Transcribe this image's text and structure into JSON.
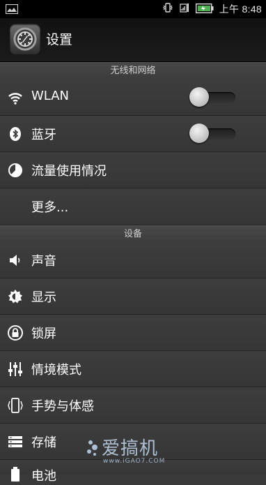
{
  "status_bar": {
    "time": "上午 8:48",
    "icons": [
      "image-notification-icon",
      "vibrate-icon",
      "signal-icon",
      "battery-icon"
    ]
  },
  "header": {
    "title": "设置",
    "icon": "settings-gear-icon"
  },
  "sections": {
    "wireless": "无线和网络",
    "device": "设备"
  },
  "items": {
    "wlan": {
      "label": "WLAN",
      "icon": "wifi-icon",
      "toggle": "off"
    },
    "bluetooth": {
      "label": "蓝牙",
      "icon": "bluetooth-icon",
      "toggle": "off"
    },
    "data_usage": {
      "label": "流量使用情况",
      "icon": "data-usage-icon"
    },
    "more": {
      "label": "更多..."
    },
    "sound": {
      "label": "声音",
      "icon": "speaker-icon"
    },
    "display": {
      "label": "显示",
      "icon": "brightness-icon"
    },
    "lock": {
      "label": "锁屏",
      "icon": "lock-icon"
    },
    "profiles": {
      "label": "情境模式",
      "icon": "sliders-icon"
    },
    "gestures": {
      "label": "手势与体感",
      "icon": "phone-gesture-icon"
    },
    "storage": {
      "label": "存储",
      "icon": "storage-icon"
    },
    "partial": {
      "label": "电池",
      "icon": "battery-icon"
    }
  },
  "watermark": {
    "title": "爱搞机",
    "url": "www.iGAO7.COM"
  },
  "colors": {
    "background": "#3a3a3a",
    "statusbar": "#000000",
    "header": "#151515"
  }
}
